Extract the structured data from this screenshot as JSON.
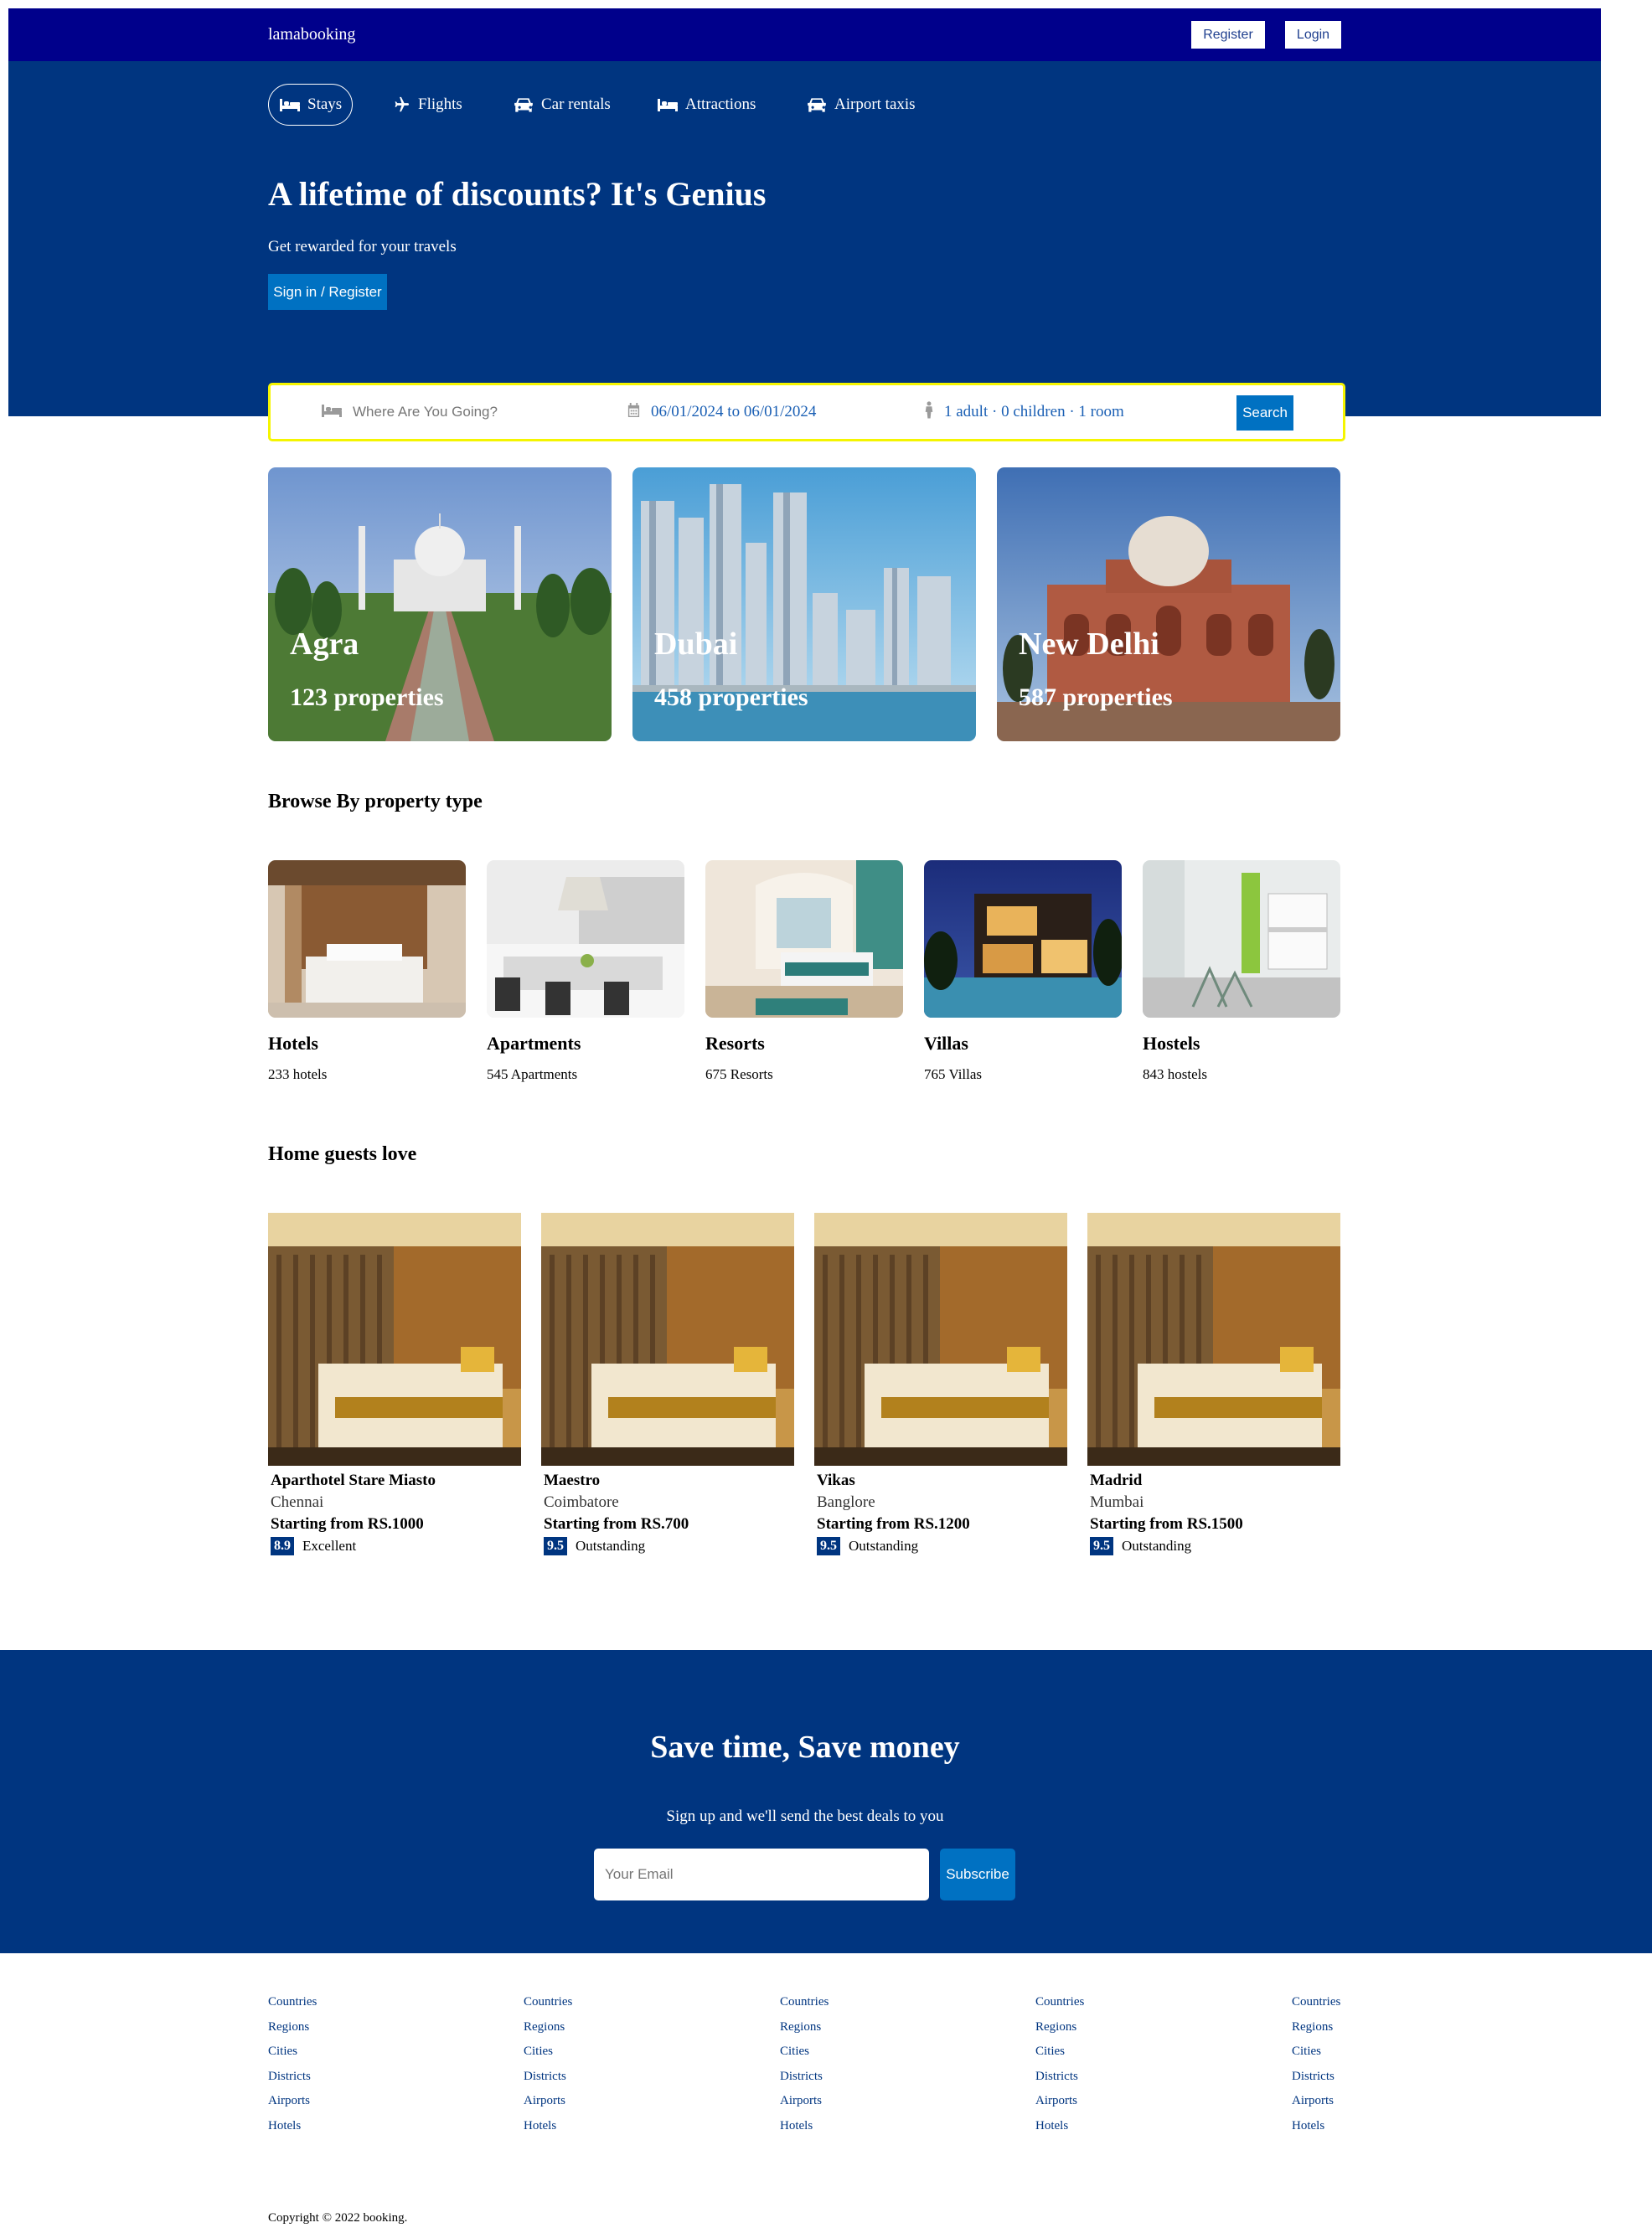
{
  "navbar": {
    "logo": "lamabooking",
    "register": "Register",
    "login": "Login"
  },
  "header": {
    "tabs": [
      {
        "label": "Stays",
        "icon": "bed-icon"
      },
      {
        "label": "Flights",
        "icon": "plane-icon"
      },
      {
        "label": "Car rentals",
        "icon": "car-icon"
      },
      {
        "label": "Attractions",
        "icon": "bed-icon"
      },
      {
        "label": "Airport taxis",
        "icon": "taxi-icon"
      }
    ],
    "title": "A lifetime of discounts? It's Genius",
    "subtitle": "Get rewarded for your travels",
    "button": "Sign in / Register"
  },
  "search": {
    "destination_placeholder": "Where Are You Going?",
    "dates": "06/01/2024 to 06/01/2024",
    "options": "1 adult · 0 children · 1 room",
    "button": "Search"
  },
  "featured": [
    {
      "city": "Agra",
      "properties": "123 properties"
    },
    {
      "city": "Dubai",
      "properties": "458 properties"
    },
    {
      "city": "New Delhi",
      "properties": "587 properties"
    }
  ],
  "property_section": {
    "title": "Browse By property type"
  },
  "property_types": [
    {
      "name": "Hotels",
      "count": "233 hotels"
    },
    {
      "name": "Apartments",
      "count": "545 Apartments"
    },
    {
      "name": "Resorts",
      "count": "675 Resorts"
    },
    {
      "name": "Villas",
      "count": "765 Villas"
    },
    {
      "name": "Hostels",
      "count": "843 hostels"
    }
  ],
  "homes_section": {
    "title": "Home guests love"
  },
  "homes": [
    {
      "name": "Aparthotel Stare Miasto",
      "city": "Chennai",
      "price": "Starting from RS.1000",
      "score": "8.9",
      "label": "Excellent"
    },
    {
      "name": "Maestro",
      "city": "Coimbatore",
      "price": "Starting from RS.700",
      "score": "9.5",
      "label": "Outstanding"
    },
    {
      "name": "Vikas",
      "city": "Banglore",
      "price": "Starting from RS.1200",
      "score": "9.5",
      "label": "Outstanding"
    },
    {
      "name": "Madrid",
      "city": "Mumbai",
      "price": "Starting from RS.1500",
      "score": "9.5",
      "label": "Outstanding"
    }
  ],
  "mail": {
    "title": "Save time, Save money",
    "description": "Sign up and we'll send the best deals to you",
    "placeholder": "Your Email",
    "button": "Subscribe"
  },
  "footer": {
    "columns": [
      [
        "Countries",
        "Regions",
        "Cities",
        "Districts",
        "Airports",
        "Hotels"
      ],
      [
        "Countries",
        "Regions",
        "Cities",
        "Districts",
        "Airports",
        "Hotels"
      ],
      [
        "Countries",
        "Regions",
        "Cities",
        "Districts",
        "Airports",
        "Hotels"
      ],
      [
        "Countries",
        "Regions",
        "Cities",
        "Districts",
        "Airports",
        "Hotels"
      ],
      [
        "Countries",
        "Regions",
        "Cities",
        "Districts",
        "Airports",
        "Hotels"
      ]
    ],
    "copyright": "Copyright © 2022 booking."
  },
  "colors": {
    "navbar": "#00008b",
    "header": "#003580",
    "button": "#0071c2",
    "search_border": "#f5f500"
  }
}
